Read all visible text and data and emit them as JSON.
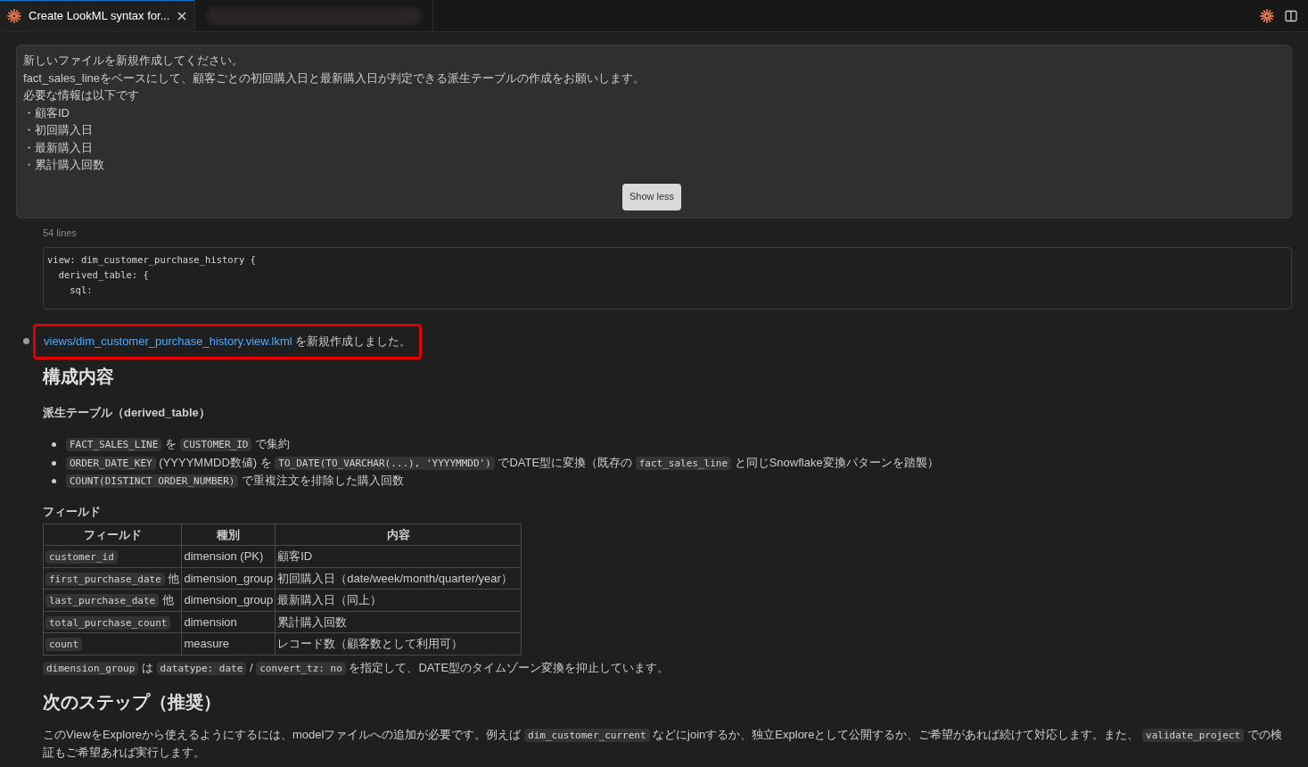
{
  "tabs": [
    {
      "kind": "chat",
      "label": "Create LookML syntax for...",
      "selected": true
    },
    {
      "kind": "redacted",
      "selected": false
    }
  ],
  "prompt": {
    "lines": [
      "新しいファイルを新規作成してください。",
      "fact_sales_lineをベースにして、顧客ごとの初回購入日と最新購入日が判定できる派生テーブルの作成をお願いします。",
      "必要な情報は以下です",
      "・顧客ID",
      "・初回購入日",
      "・最新購入日",
      "・累計購入回数"
    ],
    "toggle_button": "Show less"
  },
  "code_preview": {
    "line_count": "54 lines",
    "lines": [
      "view: dim_customer_purchase_history {",
      "  derived_table: {",
      "    sql:"
    ]
  },
  "result": {
    "highlighted": true,
    "segments": [
      {
        "kind": "link",
        "text": "views/dim_customer_purchase_history.view.lkml"
      },
      {
        "kind": "text",
        "text": " を新規作成しました。"
      }
    ]
  },
  "heading": "構成内容",
  "derived_section": {
    "title": "派生テーブル（derived_table）",
    "bullets": [
      [
        {
          "kind": "code",
          "text": "FACT_SALES_LINE"
        },
        {
          "kind": "text",
          "text": " を "
        },
        {
          "kind": "code",
          "text": "CUSTOMER_ID"
        },
        {
          "kind": "text",
          "text": " で集約"
        }
      ],
      [
        {
          "kind": "code",
          "text": "ORDER_DATE_KEY"
        },
        {
          "kind": "text",
          "text": " (YYYYMMDD数値) を "
        },
        {
          "kind": "code",
          "text": "TO_DATE(TO_VARCHAR(...), 'YYYYMMDD')"
        },
        {
          "kind": "text",
          "text": " でDATE型に変換（既存の "
        },
        {
          "kind": "code",
          "text": "fact_sales_line"
        },
        {
          "kind": "text",
          "text": " と同じSnowflake変換パターンを踏襲）"
        }
      ],
      [
        {
          "kind": "code",
          "text": "COUNT(DISTINCT ORDER_NUMBER)"
        },
        {
          "kind": "text",
          "text": " で重複注文を排除した購入回数"
        }
      ]
    ]
  },
  "fields_section": {
    "title": "フィールド",
    "table": {
      "columns": [
        "フィールド",
        "種別",
        "内容"
      ],
      "rows": [
        {
          "field": "customer_id",
          "suffix": "",
          "type": "dimension (PK)",
          "description": "顧客ID"
        },
        {
          "field": "first_purchase_date",
          "suffix": "他",
          "type": "dimension_group",
          "description": "初回購入日（date/week/month/quarter/year）"
        },
        {
          "field": "last_purchase_date",
          "suffix": "他",
          "type": "dimension_group",
          "description": "最新購入日（同上）"
        },
        {
          "field": "total_purchase_count",
          "suffix": "",
          "type": "dimension",
          "description": "累計購入回数"
        },
        {
          "field": "count",
          "suffix": "",
          "type": "measure",
          "description": "レコード数（顧客数として利用可）"
        }
      ]
    },
    "note": [
      {
        "kind": "code",
        "text": "dimension_group"
      },
      {
        "kind": "text",
        "text": " は "
      },
      {
        "kind": "code",
        "text": "datatype: date"
      },
      {
        "kind": "text",
        "text": " / "
      },
      {
        "kind": "code",
        "text": "convert_tz: no"
      },
      {
        "kind": "text",
        "text": " を指定して、DATE型のタイムゾーン変換を抑止しています。"
      }
    ]
  },
  "next_steps": {
    "title": "次のステップ（推奨）",
    "paragraph": [
      {
        "kind": "text",
        "text": "このViewをExploreから使えるようにするには、modelファイルへの追加が必要です。例えば "
      },
      {
        "kind": "code",
        "text": "dim_customer_current"
      },
      {
        "kind": "text",
        "text": " などにjoinするか、独立Exploreとして公開するか、ご希望があれば続けて対応します。また、 "
      },
      {
        "kind": "code",
        "text": "validate_project"
      },
      {
        "kind": "text",
        "text": " での検証もご希望あれば実行します。"
      }
    ]
  }
}
